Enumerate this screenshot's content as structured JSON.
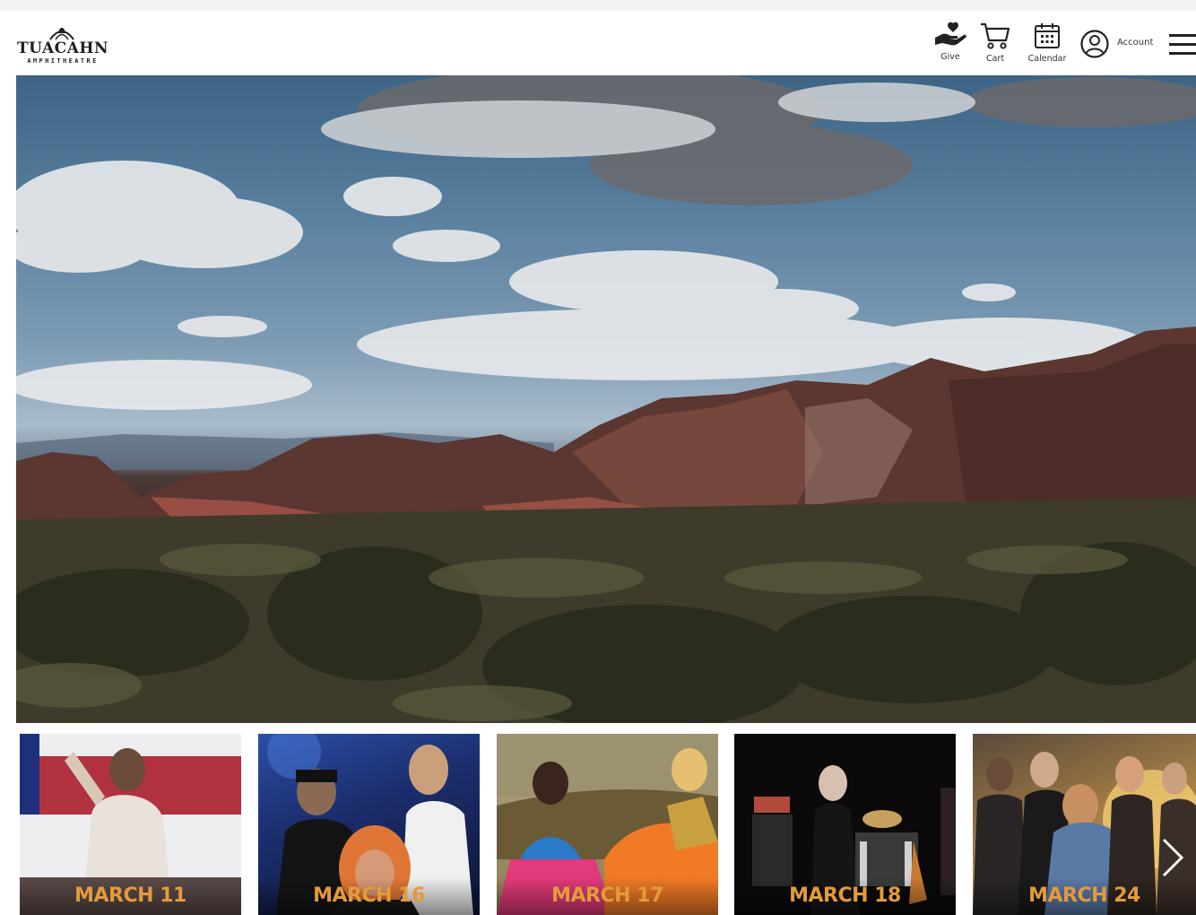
{
  "brand": {
    "name": "TUACAHN",
    "subtitle": "AMPHITHEATRE"
  },
  "header": {
    "give_label": "Give",
    "cart_label": "Cart",
    "calendar_label": "Calendar",
    "account_label": "Account"
  },
  "events": [
    {
      "date": "MARCH 11"
    },
    {
      "date": "MARCH 16"
    },
    {
      "date": "MARCH 17"
    },
    {
      "date": "MARCH 18"
    },
    {
      "date": "MARCH 24"
    }
  ],
  "colors": {
    "date_accent": "#e39a3c",
    "header_bg": "#ffffff",
    "icon": "#222222"
  },
  "icons": {
    "give": "hand-heart-icon",
    "cart": "cart-icon",
    "calendar": "calendar-icon",
    "account": "user-circle-icon",
    "menu": "hamburger-menu-icon",
    "next": "chevron-right-icon"
  }
}
